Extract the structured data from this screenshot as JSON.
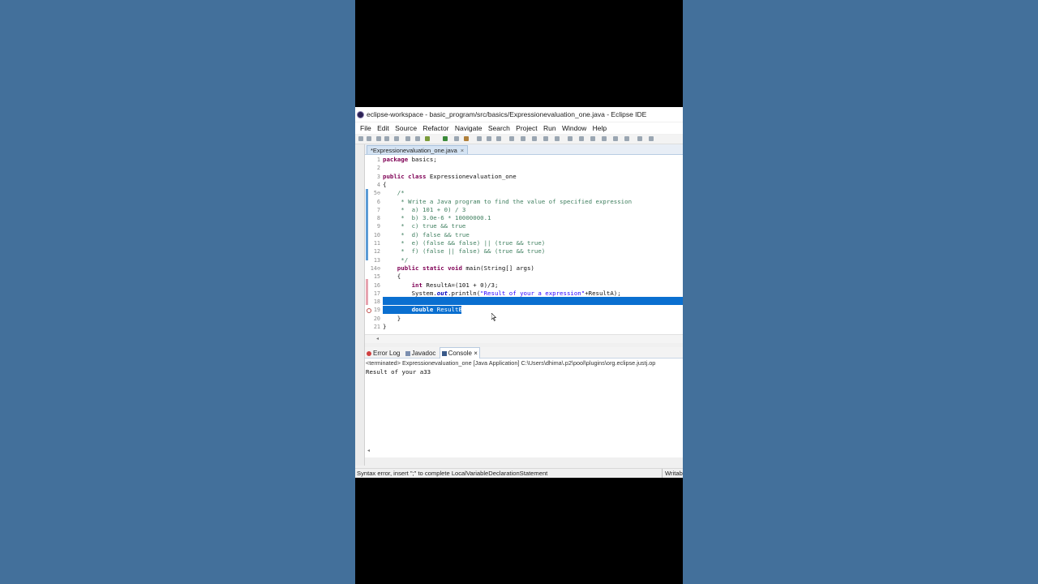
{
  "window": {
    "title": "eclipse-workspace - basic_program/src/basics/Expressionevaluation_one.java - Eclipse IDE",
    "menu": [
      "File",
      "Edit",
      "Source",
      "Refactor",
      "Navigate",
      "Search",
      "Project",
      "Run",
      "Window",
      "Help"
    ]
  },
  "editor": {
    "tab_label": "*Expressionevaluation_one.java",
    "tab_close": "×",
    "lines": [
      {
        "n": "1",
        "kw": "package",
        "rest": " basics;"
      },
      {
        "n": "2",
        "text": ""
      },
      {
        "n": "3",
        "kw": "public class",
        "rest": " Expressionevaluation_one"
      },
      {
        "n": "4",
        "text": "{"
      },
      {
        "n": "5⊖",
        "comment": "    /*"
      },
      {
        "n": "6",
        "comment": "     * Write a Java program to find the value of specified expression"
      },
      {
        "n": "7",
        "comment": "     *  a) 101 + 0) / 3"
      },
      {
        "n": "8",
        "comment": "     *  b) 3.0e-6 * 10000000.1"
      },
      {
        "n": "9",
        "comment": "     *  c) true && true"
      },
      {
        "n": "10",
        "comment": "     *  d) false && true"
      },
      {
        "n": "11",
        "comment": "     *  e) (false && false) || (true && true)"
      },
      {
        "n": "12",
        "comment": "     *  f) (false || false) && (true && true)"
      },
      {
        "n": "13",
        "comment": "     */"
      },
      {
        "n": "14⊖",
        "kw": "    public static void",
        "rest": " main(String[] args)"
      },
      {
        "n": "15",
        "text": "    {"
      },
      {
        "n": "16",
        "kw": "        int",
        "rest": " ResultA=(101 + 0)/3;"
      },
      {
        "n": "17",
        "pre": "        System.",
        "field": "out",
        "mid": ".println(",
        "str": "\"Result of your a expression\"",
        "post": "+ResultA);"
      },
      {
        "n": "18",
        "text": ""
      },
      {
        "n": "19",
        "kw": "        double",
        "rest": " ResultB"
      },
      {
        "n": "20",
        "text": "    }"
      },
      {
        "n": "21",
        "text": "}"
      }
    ]
  },
  "console": {
    "tabs": [
      "Error Log",
      "Javadoc",
      "Console"
    ],
    "active_tab": "Console",
    "terminated": "<terminated> Expressionevaluation_one [Java Application] C:\\Users\\dhima\\.p2\\pool\\plugins\\org.eclipse.justj.op",
    "output": "Result of your a33"
  },
  "status": {
    "message": "Syntax error, insert \";\" to complete LocalVariableDeclarationStatement",
    "mode": "Writab"
  },
  "colors": {
    "background": "#43709b",
    "selection": "#0a6fd0",
    "keyword": "#7f0055",
    "comment": "#3f7f5f",
    "string": "#2a00ff"
  }
}
